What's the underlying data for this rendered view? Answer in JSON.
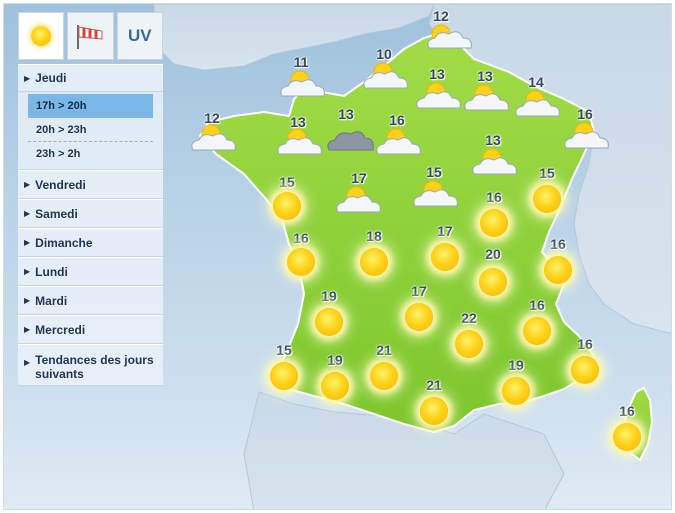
{
  "tabs": [
    {
      "name": "weather",
      "icon": "sun-icon"
    },
    {
      "name": "wind",
      "icon": "windsock-icon"
    },
    {
      "name": "uv",
      "label": "UV"
    }
  ],
  "days": [
    {
      "label": "Jeudi",
      "expanded": true,
      "slots": [
        {
          "label": "17h > 20h",
          "active": true
        },
        {
          "label": "20h > 23h",
          "active": false
        },
        {
          "label": "23h > 2h",
          "active": false
        }
      ]
    },
    {
      "label": "Vendredi"
    },
    {
      "label": "Samedi"
    },
    {
      "label": "Dimanche"
    },
    {
      "label": "Lundi"
    },
    {
      "label": "Mardi"
    },
    {
      "label": "Mercredi"
    },
    {
      "label": "Tendances des jours suivants"
    }
  ],
  "colors": {
    "land": "#8ed33a",
    "sea": "#b6d1e6",
    "sun": "#ffd21a"
  },
  "markers": [
    {
      "temp": "12",
      "icon": "partly-cloudy-icon"
    },
    {
      "temp": "11",
      "icon": "partly-cloudy-icon"
    },
    {
      "temp": "10",
      "icon": "partly-cloudy-icon"
    },
    {
      "temp": "13",
      "icon": "partly-cloudy-icon"
    },
    {
      "temp": "13",
      "icon": "partly-cloudy-icon"
    },
    {
      "temp": "14",
      "icon": "partly-cloudy-icon"
    },
    {
      "temp": "12",
      "icon": "partly-cloudy-icon"
    },
    {
      "temp": "13",
      "icon": "partly-cloudy-icon"
    },
    {
      "temp": "13",
      "icon": "cloud-icon"
    },
    {
      "temp": "16",
      "icon": "partly-cloudy-icon"
    },
    {
      "temp": "16",
      "icon": "partly-cloudy-icon"
    },
    {
      "temp": "13",
      "icon": "partly-cloudy-icon"
    },
    {
      "temp": "15",
      "icon": "sun-icon"
    },
    {
      "temp": "17",
      "icon": "partly-cloudy-icon"
    },
    {
      "temp": "15",
      "icon": "partly-cloudy-icon"
    },
    {
      "temp": "15",
      "icon": "sun-icon"
    },
    {
      "temp": "16",
      "icon": "sun-icon"
    },
    {
      "temp": "16",
      "icon": "sun-icon"
    },
    {
      "temp": "18",
      "icon": "sun-icon"
    },
    {
      "temp": "17",
      "icon": "sun-icon"
    },
    {
      "temp": "20",
      "icon": "sun-icon"
    },
    {
      "temp": "16",
      "icon": "sun-icon"
    },
    {
      "temp": "19",
      "icon": "sun-icon"
    },
    {
      "temp": "17",
      "icon": "sun-icon"
    },
    {
      "temp": "22",
      "icon": "sun-icon"
    },
    {
      "temp": "16",
      "icon": "sun-icon"
    },
    {
      "temp": "15",
      "icon": "sun-icon"
    },
    {
      "temp": "19",
      "icon": "sun-icon"
    },
    {
      "temp": "21",
      "icon": "sun-icon"
    },
    {
      "temp": "19",
      "icon": "sun-icon"
    },
    {
      "temp": "16",
      "icon": "sun-icon"
    },
    {
      "temp": "21",
      "icon": "sun-icon"
    },
    {
      "temp": "16",
      "icon": "sun-icon"
    }
  ]
}
